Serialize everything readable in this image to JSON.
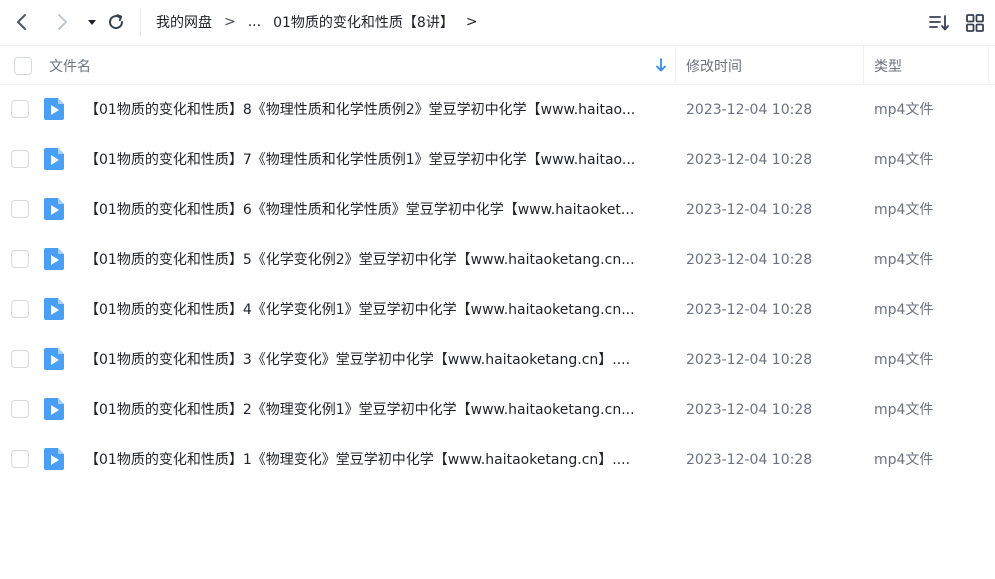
{
  "toolbar": {
    "back_icon": "chevron-left-icon",
    "forward_icon": "chevron-right-icon",
    "history_icon": "caret-down-icon",
    "refresh_icon": "refresh-icon",
    "sort_icon": "sort-list-icon",
    "view_icon": "grid-view-icon"
  },
  "breadcrumb": {
    "root": "我的网盘",
    "separator": ">",
    "ellipsis": "...",
    "current": "01物质的变化和性质【8讲】",
    "trailing_separator": ">"
  },
  "table": {
    "columns": {
      "name": "文件名",
      "modified": "修改时间",
      "type": "类型"
    },
    "rows": [
      {
        "name": "【01物质的变化和性质】8《物理性质和化学性质例2》堂豆学初中化学【www.haitao...",
        "modified": "2023-12-04 10:28",
        "type": "mp4文件"
      },
      {
        "name": "【01物质的变化和性质】7《物理性质和化学性质例1》堂豆学初中化学【www.haitao...",
        "modified": "2023-12-04 10:28",
        "type": "mp4文件"
      },
      {
        "name": "【01物质的变化和性质】6《物理性质和化学性质》堂豆学初中化学【www.haitaoket...",
        "modified": "2023-12-04 10:28",
        "type": "mp4文件"
      },
      {
        "name": "【01物质的变化和性质】5《化学变化例2》堂豆学初中化学【www.haitaoketang.cn...",
        "modified": "2023-12-04 10:28",
        "type": "mp4文件"
      },
      {
        "name": "【01物质的变化和性质】4《化学变化例1》堂豆学初中化学【www.haitaoketang.cn...",
        "modified": "2023-12-04 10:28",
        "type": "mp4文件"
      },
      {
        "name": "【01物质的变化和性质】3《化学变化》堂豆学初中化学【www.haitaoketang.cn】....",
        "modified": "2023-12-04 10:28",
        "type": "mp4文件"
      },
      {
        "name": "【01物质的变化和性质】2《物理变化例1》堂豆学初中化学【www.haitaoketang.cn...",
        "modified": "2023-12-04 10:28",
        "type": "mp4文件"
      },
      {
        "name": "【01物质的变化和性质】1《物理变化》堂豆学初中化学【www.haitaoketang.cn】....",
        "modified": "2023-12-04 10:28",
        "type": "mp4文件"
      }
    ]
  },
  "colors": {
    "accent": "#2f8cf4",
    "video_icon": "#4a9ff5",
    "text_primary": "#1f2329",
    "text_secondary": "#6b7280",
    "divider": "#eef0f2"
  }
}
